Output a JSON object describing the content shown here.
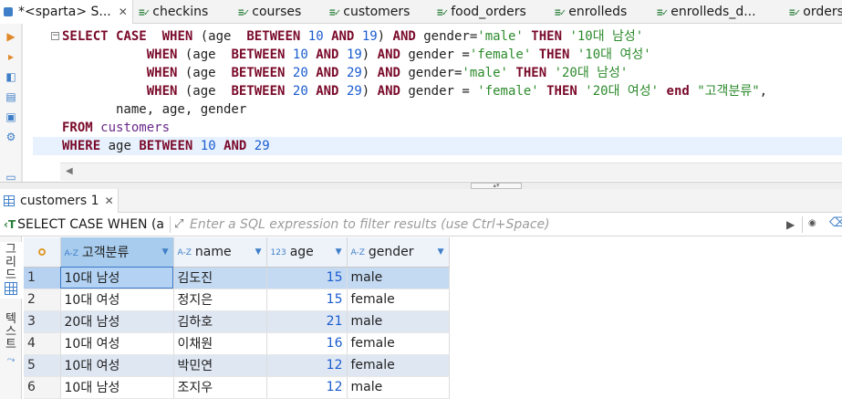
{
  "tabs": [
    {
      "label": "*<sparta> S...",
      "icon": "db-icon",
      "active": true
    },
    {
      "label": "checkins",
      "icon": "table-icon"
    },
    {
      "label": "courses",
      "icon": "table-icon"
    },
    {
      "label": "customers",
      "icon": "table-icon"
    },
    {
      "label": "food_orders",
      "icon": "table-icon"
    },
    {
      "label": "enrolleds",
      "icon": "table-icon"
    },
    {
      "label": "enrolleds_d...",
      "icon": "table-icon"
    },
    {
      "label": "orders",
      "icon": "table-icon"
    }
  ],
  "sql": {
    "lines": [
      [
        [
          "kw",
          "SELECT"
        ],
        [
          "p",
          " "
        ],
        [
          "kw",
          "CASE"
        ],
        [
          "p",
          "  "
        ],
        [
          "kw",
          "WHEN"
        ],
        [
          "p",
          " (age  "
        ],
        [
          "kw",
          "BETWEEN"
        ],
        [
          "p",
          " "
        ],
        [
          "num",
          "10"
        ],
        [
          "p",
          " "
        ],
        [
          "kw",
          "AND"
        ],
        [
          "p",
          " "
        ],
        [
          "num",
          "19"
        ],
        [
          "p",
          ") "
        ],
        [
          "kw",
          "AND"
        ],
        [
          "p",
          " gender="
        ],
        [
          "str",
          "'male'"
        ],
        [
          "p",
          " "
        ],
        [
          "kw",
          "THEN"
        ],
        [
          "p",
          " "
        ],
        [
          "str",
          "'10대 남성'"
        ]
      ],
      [
        [
          "p",
          "           "
        ],
        [
          "kw",
          "WHEN"
        ],
        [
          "p",
          " (age  "
        ],
        [
          "kw",
          "BETWEEN"
        ],
        [
          "p",
          " "
        ],
        [
          "num",
          "10"
        ],
        [
          "p",
          " "
        ],
        [
          "kw",
          "AND"
        ],
        [
          "p",
          " "
        ],
        [
          "num",
          "19"
        ],
        [
          "p",
          ") "
        ],
        [
          "kw",
          "AND"
        ],
        [
          "p",
          " gender ="
        ],
        [
          "str",
          "'female'"
        ],
        [
          "p",
          " "
        ],
        [
          "kw",
          "THEN"
        ],
        [
          "p",
          " "
        ],
        [
          "str",
          "'10대 여성'"
        ]
      ],
      [
        [
          "p",
          "           "
        ],
        [
          "kw",
          "WHEN"
        ],
        [
          "p",
          " (age  "
        ],
        [
          "kw",
          "BETWEEN"
        ],
        [
          "p",
          " "
        ],
        [
          "num",
          "20"
        ],
        [
          "p",
          " "
        ],
        [
          "kw",
          "AND"
        ],
        [
          "p",
          " "
        ],
        [
          "num",
          "29"
        ],
        [
          "p",
          ") "
        ],
        [
          "kw",
          "AND"
        ],
        [
          "p",
          " gender="
        ],
        [
          "str",
          "'male'"
        ],
        [
          "p",
          " "
        ],
        [
          "kw",
          "THEN"
        ],
        [
          "p",
          " "
        ],
        [
          "str",
          "'20대 남성'"
        ]
      ],
      [
        [
          "p",
          "           "
        ],
        [
          "kw",
          "WHEN"
        ],
        [
          "p",
          " (age  "
        ],
        [
          "kw",
          "BETWEEN"
        ],
        [
          "p",
          " "
        ],
        [
          "num",
          "20"
        ],
        [
          "p",
          " "
        ],
        [
          "kw",
          "AND"
        ],
        [
          "p",
          " "
        ],
        [
          "num",
          "29"
        ],
        [
          "p",
          ") "
        ],
        [
          "kw",
          "AND"
        ],
        [
          "p",
          " gender = "
        ],
        [
          "str",
          "'female'"
        ],
        [
          "p",
          " "
        ],
        [
          "kw",
          "THEN"
        ],
        [
          "p",
          " "
        ],
        [
          "str",
          "'20대 여성'"
        ],
        [
          "p",
          " "
        ],
        [
          "kw",
          "end"
        ],
        [
          "p",
          " "
        ],
        [
          "str",
          "\"고객분류\""
        ],
        [
          "p",
          ","
        ]
      ],
      [
        [
          "p",
          "       name, age, gender"
        ]
      ],
      [
        [
          "kw",
          "FROM"
        ],
        [
          "p",
          " "
        ],
        [
          "id",
          "customers"
        ]
      ],
      [
        [
          "kw",
          "WHERE"
        ],
        [
          "p",
          " age "
        ],
        [
          "kw",
          "BETWEEN"
        ],
        [
          "p",
          " "
        ],
        [
          "num",
          "10"
        ],
        [
          "p",
          " "
        ],
        [
          "kw",
          "AND"
        ],
        [
          "p",
          " "
        ],
        [
          "num",
          "29"
        ]
      ]
    ]
  },
  "results": {
    "tab_label": "customers 1",
    "filter": {
      "query": "SELECT CASE WHEN (a",
      "placeholder": "Enter a SQL expression to filter results (use Ctrl+Space)"
    },
    "side_tabs": {
      "grid": "그리드",
      "text": "텍스트"
    },
    "columns": [
      {
        "name": "고객분류",
        "type": "A-Z"
      },
      {
        "name": "name",
        "type": "A-Z"
      },
      {
        "name": "age",
        "type": "123"
      },
      {
        "name": "gender",
        "type": "A-Z"
      }
    ],
    "rows": [
      [
        "1",
        "10대 남성",
        "김도진",
        "15",
        "male"
      ],
      [
        "2",
        "10대 여성",
        "정지은",
        "15",
        "female"
      ],
      [
        "3",
        "20대 남성",
        "김하호",
        "21",
        "male"
      ],
      [
        "4",
        "10대 여성",
        "이채원",
        "16",
        "female"
      ],
      [
        "5",
        "10대 여성",
        "박민연",
        "12",
        "female"
      ],
      [
        "6",
        "10대 남성",
        "조지우",
        "12",
        "male"
      ]
    ]
  },
  "colors": {
    "keyword": "#7a0a2a",
    "number": "#1a5cd0",
    "string": "#2c8a2c",
    "selection": "#b4d3f4"
  }
}
